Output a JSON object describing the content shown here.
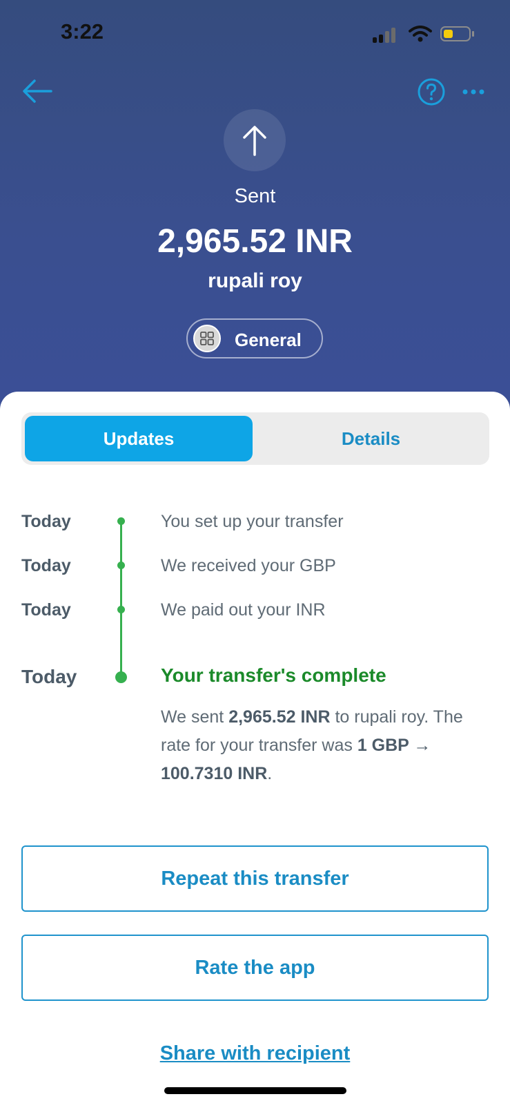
{
  "status_bar": {
    "time": "3:22"
  },
  "header": {
    "status_label": "Sent",
    "amount": "2,965.52 INR",
    "recipient": "rupali roy",
    "category": "General",
    "icons": {
      "back": "arrow-left-icon",
      "help": "question-circle-icon",
      "more": "more-dots-icon",
      "direction": "arrow-up-icon",
      "category": "grid-icon"
    }
  },
  "tabs": {
    "updates": "Updates",
    "details": "Details",
    "active": "Updates"
  },
  "timeline": {
    "steps": [
      {
        "date": "Today",
        "text": "You set up your transfer"
      },
      {
        "date": "Today",
        "text": "We received your GBP"
      },
      {
        "date": "Today",
        "text": "We paid out your INR"
      }
    ],
    "final": {
      "date": "Today",
      "title": "Your transfer's complete",
      "body_1": "We sent ",
      "body_amount": "2,965.52 INR",
      "body_2": " to rupali roy. The rate for your transfer was ",
      "body_rate": "1 GBP → 100.7310 INR",
      "body_3": "."
    }
  },
  "actions": {
    "repeat": "Repeat this transfer",
    "rate": "Rate the app",
    "share": "Share with recipient"
  },
  "colors": {
    "accent": "#0ea5e6",
    "link": "#1a8cc4",
    "success": "#36b04f",
    "success_text": "#1b8a2a",
    "header_bg": "#3a4f8f"
  }
}
